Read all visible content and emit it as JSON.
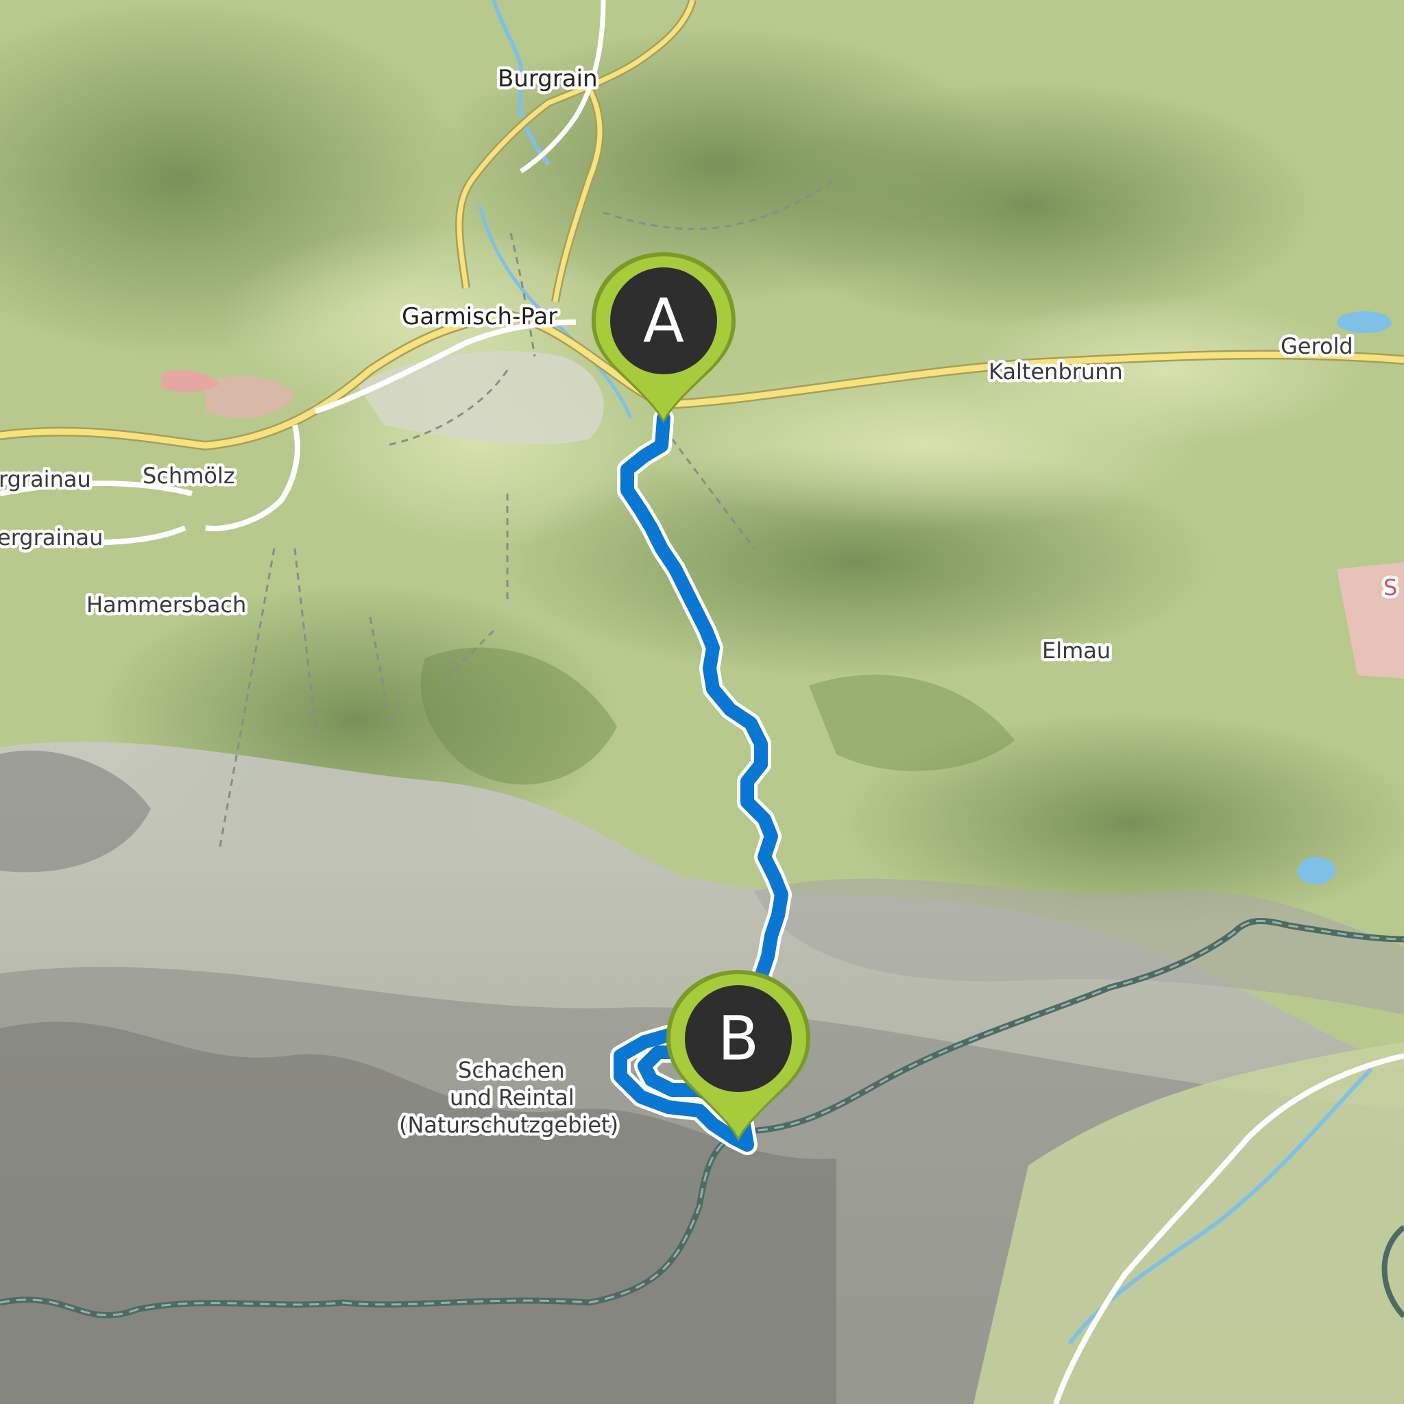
{
  "map": {
    "places": [
      {
        "key": "burgrain",
        "label": "Burgrain"
      },
      {
        "key": "garmisch",
        "label": "Garmisch-Par"
      },
      {
        "key": "gerold",
        "label": "Gerold"
      },
      {
        "key": "kaltenbrunn",
        "label": "Kaltenbrunn"
      },
      {
        "key": "grainau1",
        "label": "rgrainau"
      },
      {
        "key": "schmoelz",
        "label": "Schmölz"
      },
      {
        "key": "grainau2",
        "label": "ergrainau"
      },
      {
        "key": "hammersbach",
        "label": "Hammersbach"
      },
      {
        "key": "elmau",
        "label": "Elmau"
      },
      {
        "key": "schachen1",
        "label": "Schachen"
      },
      {
        "key": "schachen2",
        "label": "und Reintal"
      },
      {
        "key": "schachen3",
        "label": "(Naturschutzgebiet)"
      },
      {
        "key": "edge_s",
        "label": "S"
      }
    ],
    "markers": [
      {
        "key": "start",
        "letter": "A"
      },
      {
        "key": "end",
        "letter": "B"
      }
    ],
    "colors": {
      "route": "#0a78d2",
      "marker_fill": "#9dc43a",
      "marker_inner": "#2e2e2e",
      "road": "#f6e37d",
      "border": "#4f6a63",
      "water": "#7fc0e6"
    }
  }
}
